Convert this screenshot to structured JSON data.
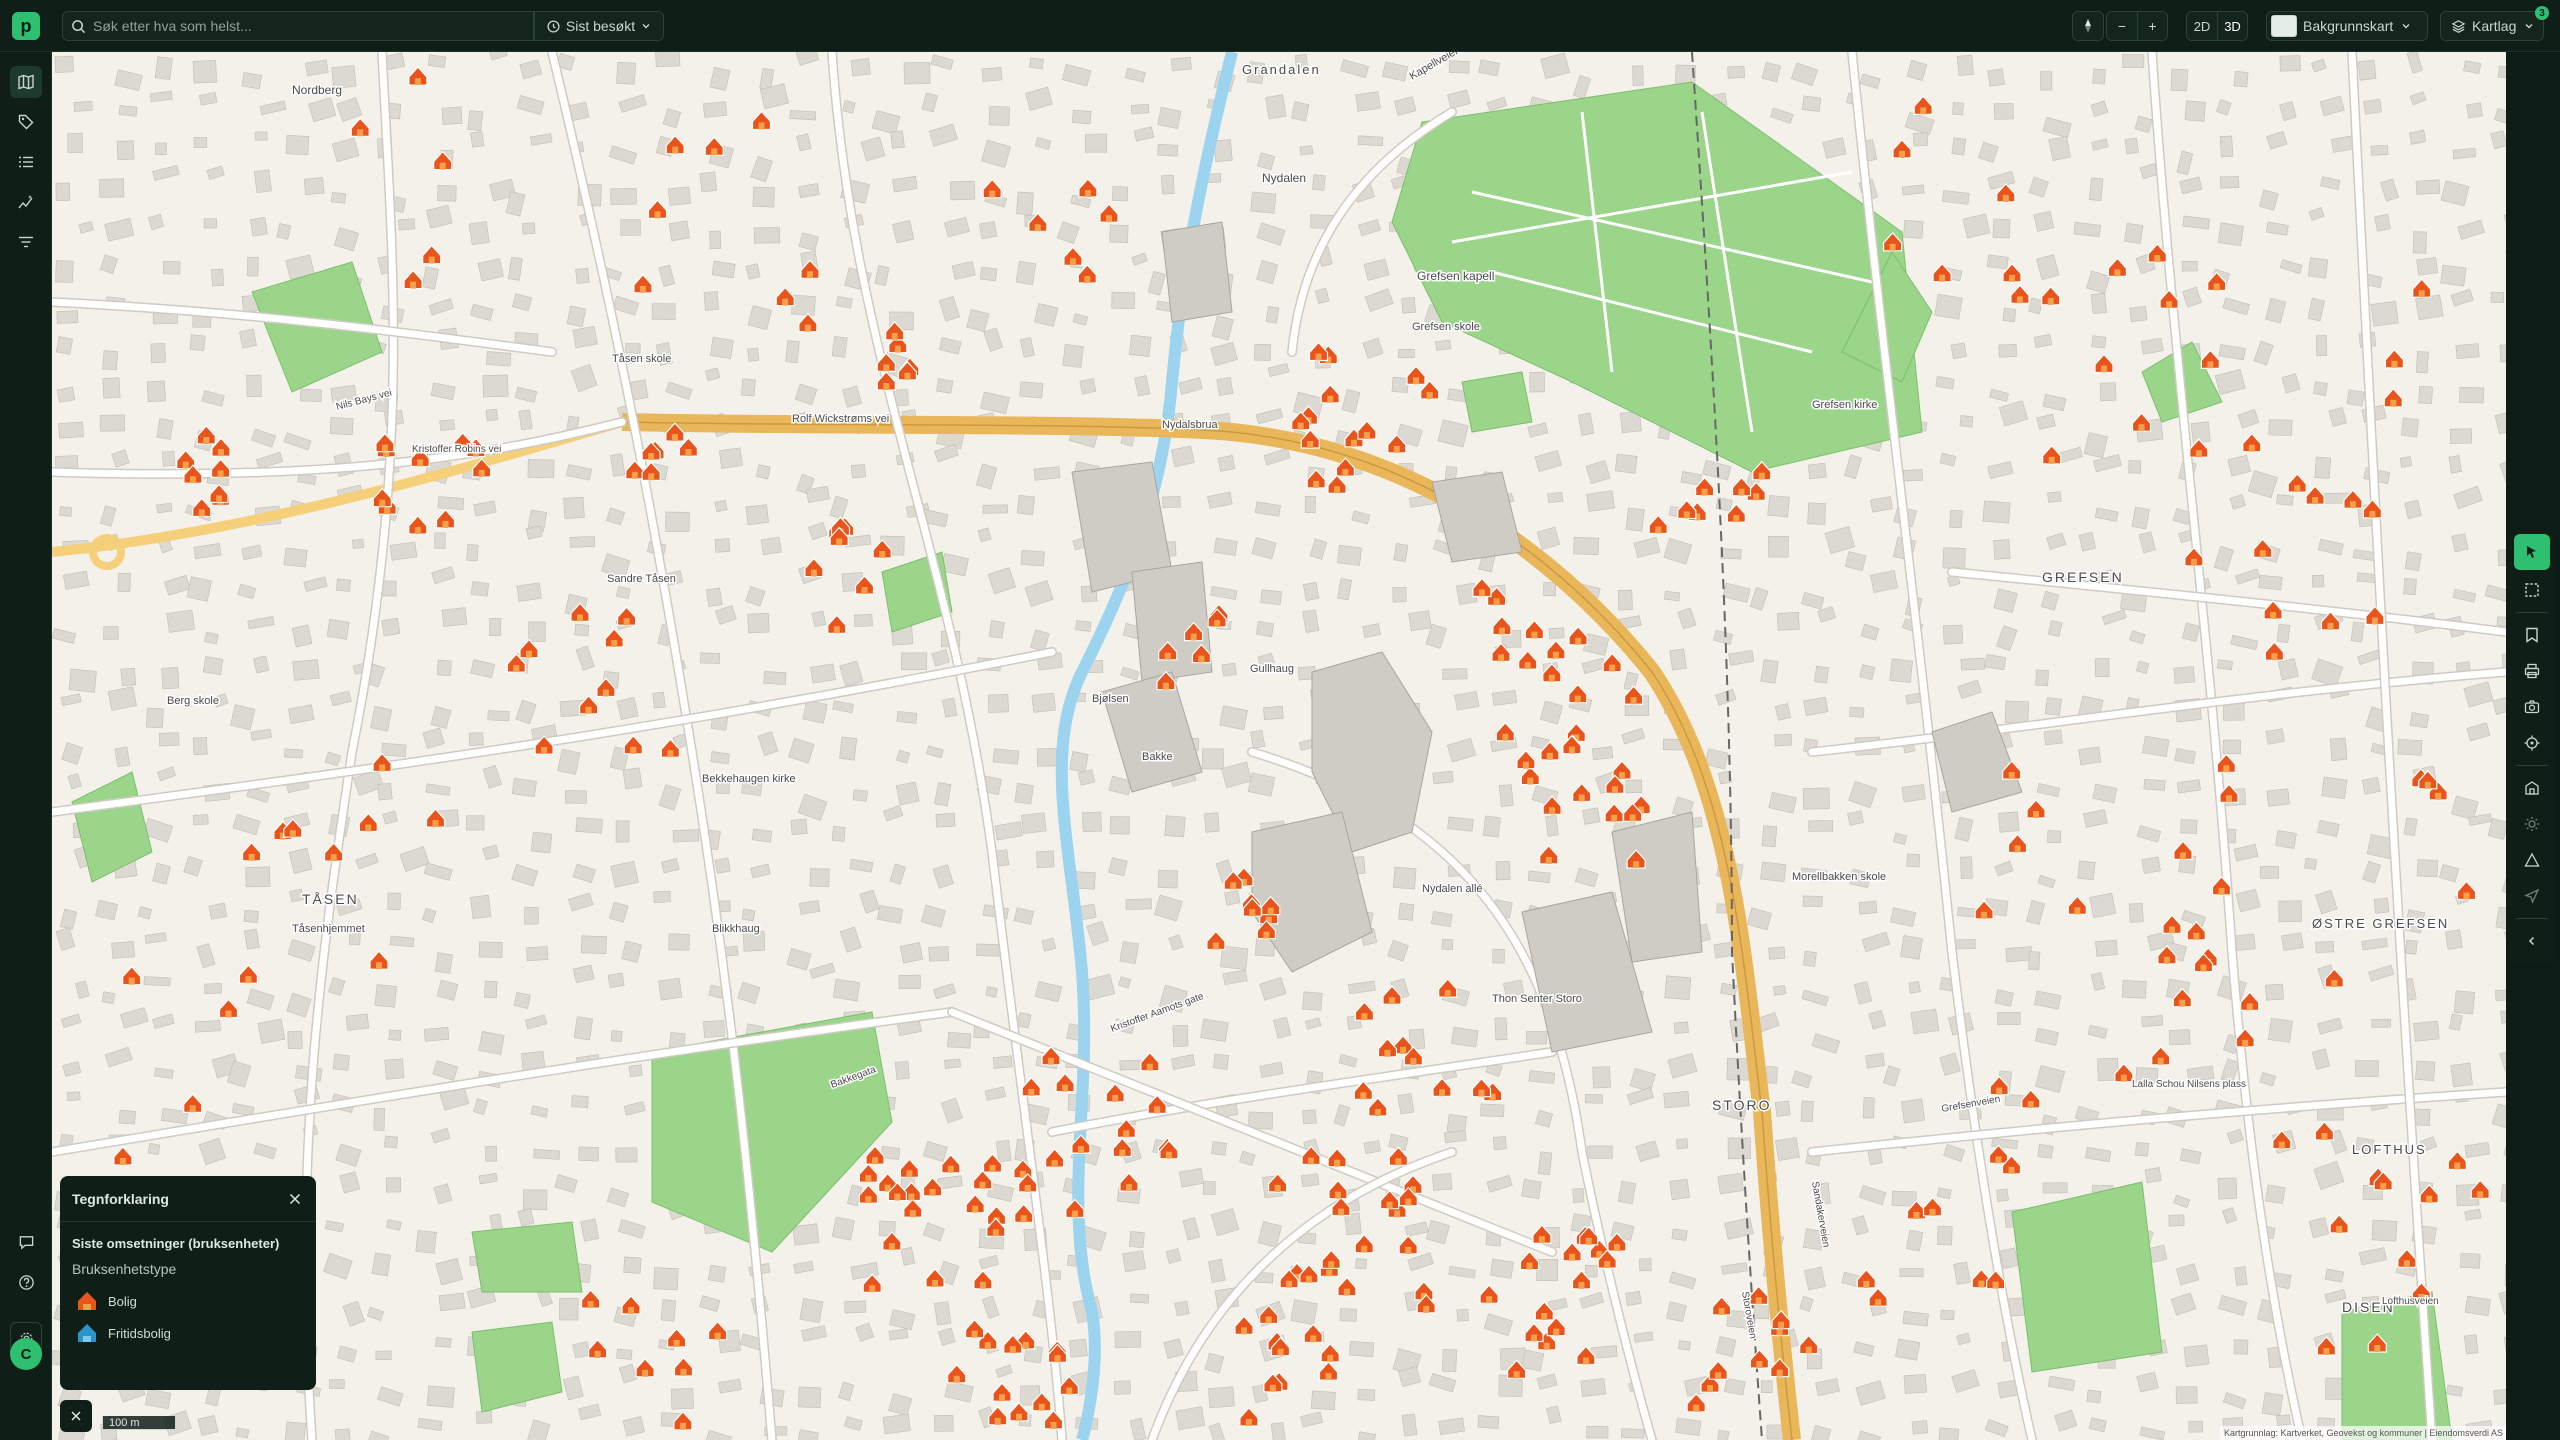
{
  "app": {
    "logo_letter": "p"
  },
  "search": {
    "placeholder": "Søk etter hva som helst...",
    "recent_label": "Sist besøkt"
  },
  "map_controls": {
    "zoom_out": "−",
    "zoom_in": "+",
    "mode_2d": "2D",
    "mode_3d": "3D",
    "basemap_label": "Bakgrunnskart",
    "layers_label": "Kartlag",
    "layers_count": "3"
  },
  "user": {
    "initial": "C"
  },
  "legend": {
    "title": "Tegnforklaring",
    "subtitle": "Siste omsetninger (bruksenheter)",
    "type_heading": "Bruksenhetstype",
    "items": [
      {
        "label": "Bolig",
        "color": "#e8541c"
      },
      {
        "label": "Fritidsbolig",
        "color": "#2a93c9"
      }
    ]
  },
  "scale": {
    "label": "100 m"
  },
  "attribution": "Kartgrunnlag: Kartverket, Geovekst og kommuner | Eiendomsverdi AS",
  "colors": {
    "accent": "#2fbf71",
    "sale_marker": "#e8541c",
    "park": "#8fd17f",
    "highway": "#e9b65a",
    "river": "#9cd3ee"
  },
  "map": {
    "place_labels": [
      "Grandalen",
      "Nordberg",
      "Kapellveien",
      "Nydalen",
      "Grefsen kapell",
      "Grefsen skole",
      "Grefsen kirke",
      "Tåsen skole",
      "Rolf Wickstrøms vei",
      "Nydalsbrua",
      "Nils Bays vei",
      "Kristoffer Robins vei",
      "Sandre Tåsen",
      "Berg skole",
      "GREFSEN",
      "Gullhaug",
      "Bjølsen",
      "Bakke",
      "Blikkhaug",
      "Bekkehaugen kirke",
      "TÅSEN",
      "Tåsenhjemmet",
      "Nydalen allé",
      "Thon Senter Storo",
      "Morellbakken skole",
      "ØSTRE GREFSEN",
      "STORO",
      "LOFTHUS",
      "Lalla Schou Nilsens plass",
      "DISEN",
      "Kristoffer Aamots gate",
      "Bakkegata",
      "Storoveien",
      "Sandakerveien",
      "Grefsenveien",
      "Lofthusveien"
    ]
  }
}
